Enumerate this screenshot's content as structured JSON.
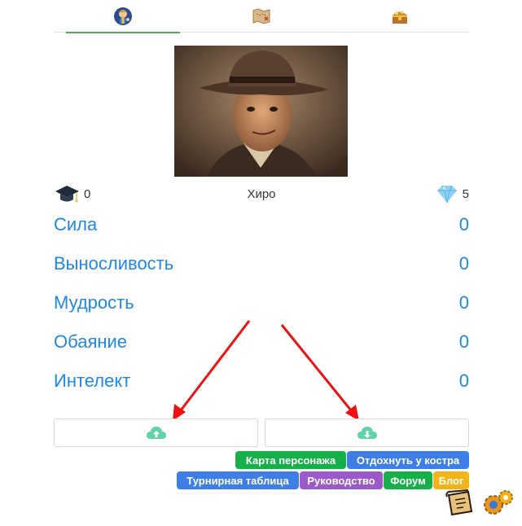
{
  "tabs": [
    {
      "icon": "vault-boy-icon",
      "active": true
    },
    {
      "icon": "treasure-map-icon",
      "active": false
    },
    {
      "icon": "treasure-chest-icon",
      "active": false
    }
  ],
  "character": {
    "name": "Хиро",
    "education": "0",
    "gems": "5"
  },
  "stats": [
    {
      "label": "Сила",
      "value": "0"
    },
    {
      "label": "Выносливость",
      "value": "0"
    },
    {
      "label": "Мудрость",
      "value": "0"
    },
    {
      "label": "Обаяние",
      "value": "0"
    },
    {
      "label": "Интелект",
      "value": "0"
    }
  ],
  "actions": {
    "upload_icon": "cloud-upload-icon",
    "download_icon": "cloud-download-icon"
  },
  "links": {
    "character_map": "Карта персонажа",
    "rest": "Отдохнуть у костра",
    "tournament": "Турнирная таблица",
    "guide": "Руководство",
    "forum": "Форум",
    "blog": "Блог"
  },
  "colors": {
    "stat_blue": "#1e88e5",
    "tab_active": "#4cae4c",
    "chip_green": "#16b04a",
    "chip_blue": "#3d7fe6",
    "chip_purple": "#9b59c9",
    "chip_yellow": "#f2b418",
    "cloud_green": "#5fd3a6",
    "arrow_red": "#ee1111"
  },
  "bottom_icons": [
    "scroll-icon",
    "gears-icon"
  ]
}
